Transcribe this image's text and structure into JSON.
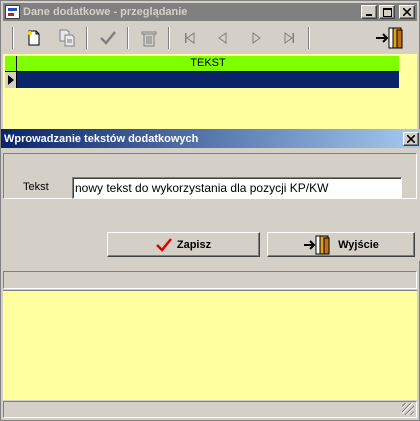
{
  "outer_window": {
    "title": "Dane dodatkowe - przeglądanie",
    "caption_buttons": [
      "minimize",
      "maximize",
      "close"
    ]
  },
  "toolbar": {
    "buttons": [
      {
        "name": "new-record",
        "icon": "new-document-icon"
      },
      {
        "name": "copy-record",
        "icon": "copy-document-icon"
      },
      {
        "name": "accept",
        "icon": "check-icon"
      },
      {
        "name": "delete",
        "icon": "trash-icon"
      },
      {
        "name": "first",
        "icon": "first-record-icon"
      },
      {
        "name": "previous",
        "icon": "prev-record-icon"
      },
      {
        "name": "next",
        "icon": "next-record-icon"
      },
      {
        "name": "last",
        "icon": "last-record-icon"
      },
      {
        "name": "exit",
        "icon": "exit-door-icon"
      }
    ]
  },
  "grid": {
    "columns": [
      "TEKST"
    ],
    "header_color": "#80ff00",
    "selected_row_color": "#0a246a",
    "background_color": "#ffffa0",
    "rows": [
      ""
    ]
  },
  "dialog": {
    "title": "Wprowadzanie tekstów dodatkowych",
    "field_label": "Tekst",
    "field_value": "nowy tekst do wykorzystania dla pozycji KP/KW",
    "save_label": "Zapisz",
    "exit_label": "Wyjście",
    "save_icon_color": "#e00000"
  }
}
